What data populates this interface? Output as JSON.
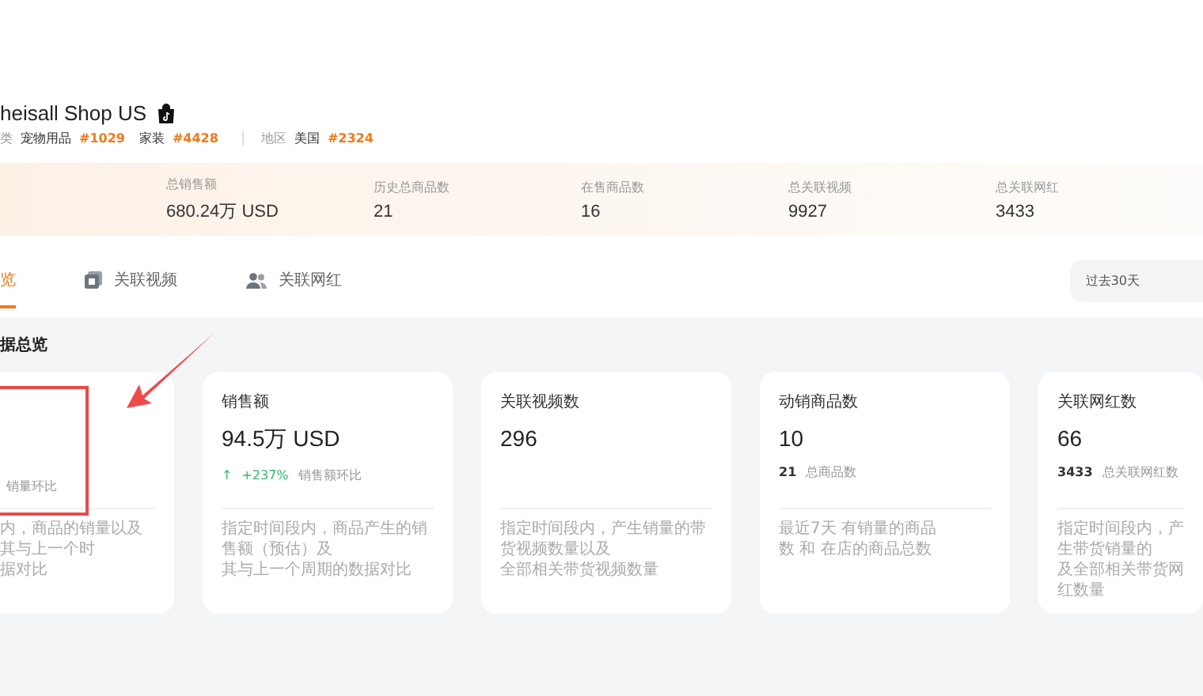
{
  "shop": {
    "name": "heisall Shop US",
    "categories": {
      "label": "类",
      "items": [
        {
          "name": "宠物用品",
          "rank": "#1029"
        },
        {
          "name": "家装",
          "rank": "#4428"
        }
      ]
    },
    "region": {
      "label": "地区",
      "items": [
        {
          "name": "美国",
          "rank": "#2324"
        }
      ]
    }
  },
  "stats": [
    {
      "label": "总销售额",
      "value": "680.24万 USD"
    },
    {
      "label": "历史总商品数",
      "value": "21"
    },
    {
      "label": "在售商品数",
      "value": "16"
    },
    {
      "label": "总关联视频",
      "value": "9927"
    },
    {
      "label": "总关联网红",
      "value": "3433"
    }
  ],
  "tabs": [
    {
      "label": "览",
      "selected": true
    },
    {
      "label": "关联视频",
      "selected": false
    },
    {
      "label": "关联网红",
      "selected": false
    }
  ],
  "period": {
    "value": "过去30天"
  },
  "section_title": "据总览",
  "cards": [
    {
      "kind": "change",
      "compare_label": "销量环比",
      "description": [
        "内，商品的销量以及其与上一个时",
        "据对比"
      ]
    },
    {
      "kind": "change",
      "title": "销售额",
      "value": "94.5万 USD",
      "arrow": "↑",
      "change": "+237%",
      "compare_label": "销售额环比",
      "description": [
        "指定时间段内，商品产生的销售额（预估）及",
        "其与上一个周期的数据对比"
      ]
    },
    {
      "kind": "plain",
      "title": "关联视频数",
      "value": "296",
      "description": [
        "指定时间段内，产生销量的带货视频数量以及",
        "全部相关带货视频数量"
      ]
    },
    {
      "kind": "total",
      "title": "动销商品数",
      "value": "10",
      "total": "21",
      "total_label": "总商品数",
      "description": [
        "最近7天 有销量的商品数 和 在店的商品总数"
      ]
    },
    {
      "kind": "total",
      "title": "关联网红数",
      "value": "66",
      "total": "3433",
      "total_label": "总关联网红数",
      "description": [
        "指定时间段内，产生带货销量的",
        "及全部相关带货网红数量"
      ]
    }
  ]
}
